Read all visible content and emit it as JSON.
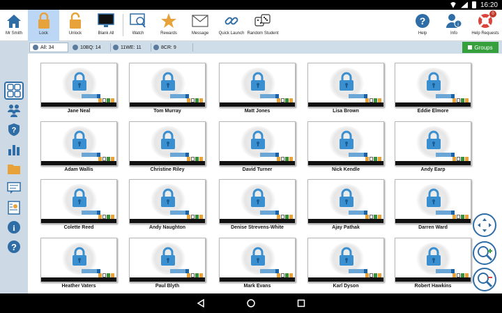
{
  "status": {
    "time": "16:20"
  },
  "user": {
    "name": "Mr Smith"
  },
  "toolbar": {
    "items": [
      {
        "label": "Lock",
        "icon": "lock-icon"
      },
      {
        "label": "Unlock",
        "icon": "unlock-icon"
      },
      {
        "label": "Blank All",
        "icon": "monitor-icon"
      },
      {
        "label": "Watch",
        "icon": "watch-icon"
      },
      {
        "label": "Rewards",
        "icon": "star-icon"
      },
      {
        "label": "Message",
        "icon": "envelope-icon"
      },
      {
        "label": "Quick Launch",
        "icon": "link-icon"
      },
      {
        "label": "Random Student",
        "icon": "dice-icon"
      }
    ],
    "help": "Help",
    "info": "Info",
    "help_requests": "Help Requests",
    "help_requests_badge": "0"
  },
  "filters": {
    "all": "All: 34",
    "group1": "10BQ: 14",
    "group2": "11WE: 11",
    "group3": "8CR: 9",
    "groups_button": "Groups"
  },
  "students": [
    "Jane Neal",
    "Tom Murray",
    "Matt Jones",
    "Lisa Brown",
    "Eddie Elmore",
    "Adam Wallis",
    "Christine Riley",
    "David Turner",
    "Nick Kendle",
    "Andy Earp",
    "Colette Reed",
    "Andy Naughton",
    "Denise Strevens-White",
    "Ajay Pathak",
    "Darren Ward",
    "Heather Vaters",
    "Paul Blyth",
    "Mark Evans",
    "Karl Dyson",
    "Robert Hawkins"
  ],
  "colors": {
    "accent": "#2f6da6",
    "active": "#bcd7f5",
    "groups": "#35a03c",
    "sidebar": "#cdd9e4"
  }
}
